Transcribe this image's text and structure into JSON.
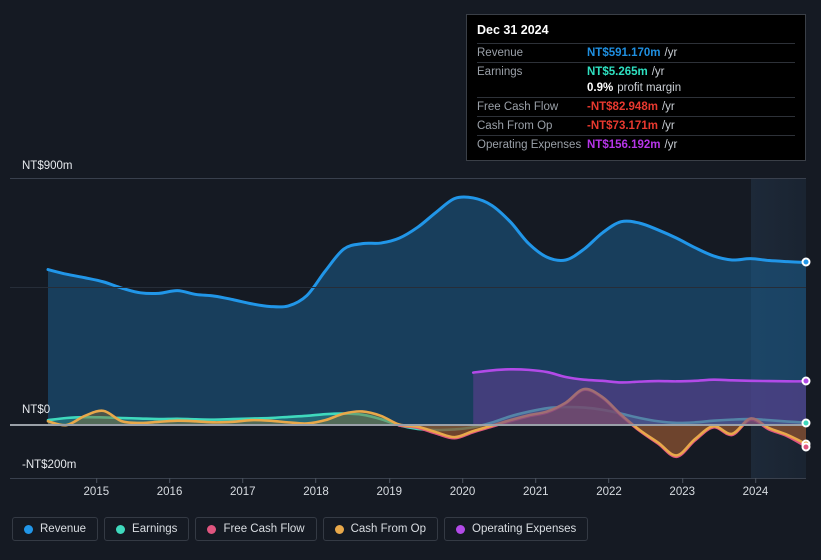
{
  "theme": {
    "background": "#151a23",
    "plot_background": "#11161f",
    "zero_line": "#9aa0a8",
    "grid": "#39404d"
  },
  "tooltip": {
    "title": "Dec 31 2024",
    "rows": [
      {
        "label": "Revenue",
        "value": "NT$591.170m",
        "unit": "/yr",
        "color": "#1f8fe0"
      },
      {
        "label": "Earnings",
        "value": "NT$5.265m",
        "unit": "/yr",
        "color": "#2ee0c0"
      },
      {
        "label": "",
        "value": "0.9%",
        "unit": "profit margin",
        "color": "#ffffff",
        "sub": true
      },
      {
        "label": "Free Cash Flow",
        "value": "-NT$82.948m",
        "unit": "/yr",
        "color": "#e8392f"
      },
      {
        "label": "Cash From Op",
        "value": "-NT$73.171m",
        "unit": "/yr",
        "color": "#e8392f"
      },
      {
        "label": "Operating Expenses",
        "value": "NT$156.192m",
        "unit": "/yr",
        "color": "#b635e8"
      }
    ]
  },
  "legend": {
    "items": [
      {
        "label": "Revenue",
        "color": "#2196e8"
      },
      {
        "label": "Earnings",
        "color": "#3fd9bd"
      },
      {
        "label": "Free Cash Flow",
        "color": "#e0557f"
      },
      {
        "label": "Cash From Op",
        "color": "#e8a84a"
      },
      {
        "label": "Operating Expenses",
        "color": "#b24ae8"
      }
    ]
  },
  "chart_data": {
    "type": "area",
    "title": "",
    "xlabel": "",
    "ylabel": "NT$",
    "currency": "NT$",
    "unit": "m",
    "ylim": [
      -200,
      900
    ],
    "grid": true,
    "gridlines": [
      900,
      500,
      0,
      -200
    ],
    "y_ticks": [
      {
        "value": 900,
        "label": "NT$900m"
      },
      {
        "value": 0,
        "label": "NT$0"
      },
      {
        "value": -200,
        "label": "-NT$200m"
      }
    ],
    "x_ticks": [
      "2015",
      "2016",
      "2017",
      "2018",
      "2019",
      "2020",
      "2021",
      "2022",
      "2023",
      "2024"
    ],
    "x_range": [
      "2014-06",
      "2025-03"
    ],
    "forecast_band": {
      "start": "2024-04",
      "end": "2025-03",
      "label": ""
    },
    "legend_position": "bottom",
    "series": [
      {
        "name": "Revenue",
        "color": "#2196e8",
        "fill": "rgba(28,92,140,0.55)",
        "values": [
          565,
          548,
          535,
          520,
          497,
          480,
          478,
          488,
          474,
          468,
          455,
          440,
          430,
          432,
          470,
          560,
          640,
          660,
          662,
          680,
          720,
          775,
          825,
          827,
          800,
          740,
          660,
          610,
          600,
          640,
          700,
          740,
          735,
          710,
          680,
          645,
          615,
          600,
          605,
          598,
          594,
          591
        ]
      },
      {
        "name": "Earnings",
        "color": "#3fd9bd",
        "fill": "rgba(63,217,189,0.28)",
        "values": [
          14,
          22,
          25,
          24,
          22,
          20,
          18,
          19,
          17,
          16,
          18,
          20,
          22,
          26,
          30,
          36,
          38,
          34,
          18,
          -5,
          -18,
          -22,
          -20,
          -12,
          5,
          28,
          45,
          58,
          62,
          60,
          52,
          38,
          22,
          10,
          4,
          6,
          12,
          16,
          18,
          14,
          9,
          5
        ]
      },
      {
        "name": "Free Cash Flow",
        "color": "#e0557f",
        "fill": "rgba(140,40,48,0.55)",
        "start_index": 19,
        "values": [
          null,
          null,
          null,
          null,
          null,
          null,
          null,
          null,
          null,
          null,
          null,
          null,
          null,
          null,
          null,
          null,
          null,
          null,
          null,
          -6,
          -14,
          -35,
          -52,
          -30,
          -10,
          10,
          28,
          42,
          75,
          125,
          95,
          30,
          -25,
          -72,
          -120,
          -60,
          -12,
          -40,
          15,
          -20,
          -45,
          -83
        ]
      },
      {
        "name": "Cash From Op",
        "color": "#e8a84a",
        "fill": "rgba(140,110,50,0.45)",
        "values": [
          10,
          -4,
          30,
          48,
          10,
          4,
          8,
          12,
          10,
          6,
          8,
          14,
          12,
          6,
          2,
          14,
          38,
          46,
          30,
          -2,
          -10,
          -30,
          -48,
          -26,
          -6,
          14,
          32,
          46,
          78,
          128,
          98,
          34,
          -22,
          -68,
          -115,
          -55,
          -8,
          -36,
          20,
          -15,
          -40,
          -73
        ]
      },
      {
        "name": "Operating Expenses",
        "color": "#b24ae8",
        "fill": "rgba(102,62,150,0.55)",
        "start_index": 23,
        "values": [
          null,
          null,
          null,
          null,
          null,
          null,
          null,
          null,
          null,
          null,
          null,
          null,
          null,
          null,
          null,
          null,
          null,
          null,
          null,
          null,
          null,
          null,
          null,
          188,
          196,
          200,
          198,
          190,
          172,
          162,
          158,
          152,
          155,
          157,
          156,
          158,
          162,
          160,
          158,
          157,
          156,
          156
        ]
      }
    ],
    "endpoints": [
      {
        "series": "Revenue",
        "value": 591,
        "color": "#2196e8"
      },
      {
        "series": "Operating Expenses",
        "value": 156,
        "color": "#b24ae8"
      },
      {
        "series": "Earnings",
        "value": 5,
        "color": "#3fd9bd"
      },
      {
        "series": "Cash From Op",
        "value": -73,
        "color": "#e8a84a"
      },
      {
        "series": "Free Cash Flow",
        "value": -83,
        "color": "#e0557f"
      }
    ]
  }
}
